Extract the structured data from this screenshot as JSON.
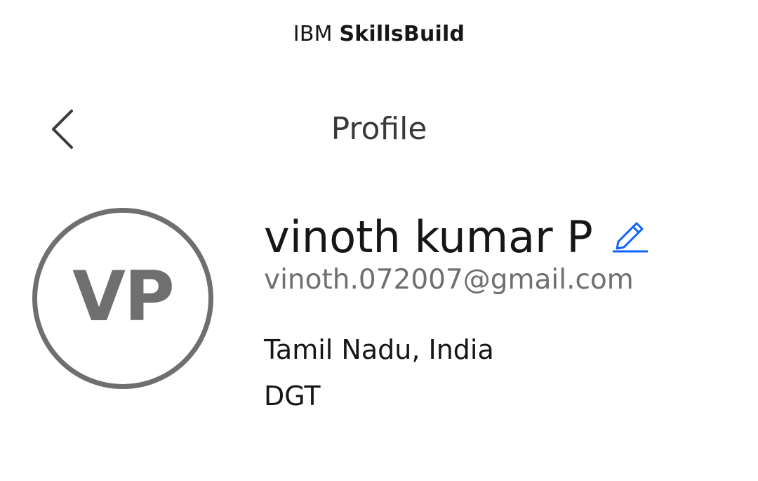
{
  "header": {
    "brand_prefix": "IBM",
    "brand_product": "SkillsBuild"
  },
  "nav": {
    "back_icon": "chevron-left-icon",
    "title": "Profile"
  },
  "profile": {
    "initials": "VP",
    "name": "vinoth kumar P",
    "email": "vinoth.072007@gmail.com",
    "location": "Tamil Nadu, India",
    "organization": "DGT",
    "edit_icon": "pencil-icon"
  },
  "colors": {
    "text_primary": "#161616",
    "text_secondary": "#6f6f6f",
    "avatar_gray": "#6f6f6f",
    "link_blue": "#0f62fe"
  }
}
